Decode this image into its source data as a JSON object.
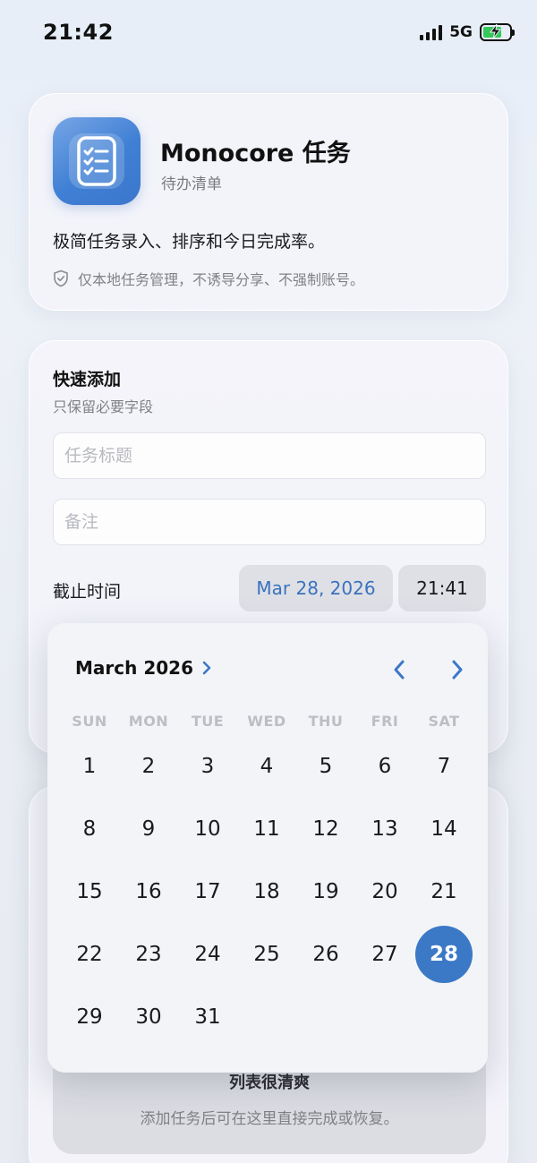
{
  "status": {
    "time": "21:42",
    "network": "5G"
  },
  "app": {
    "title": "Monocore 任务",
    "subtitle": "待办清单",
    "description": "极简任务录入、排序和今日完成率。",
    "privacy": "仅本地任务管理，不诱导分享、不强制账号。"
  },
  "quick_add": {
    "title": "快速添加",
    "subtitle": "只保留必要字段",
    "title_placeholder": "任务标题",
    "note_placeholder": "备注",
    "due_label": "截止时间",
    "due_date": "Mar 28, 2026",
    "due_time": "21:41"
  },
  "calendar": {
    "month_label": "March 2026",
    "weekdays": [
      "SUN",
      "MON",
      "TUE",
      "WED",
      "THU",
      "FRI",
      "SAT"
    ],
    "days": [
      "1",
      "2",
      "3",
      "4",
      "5",
      "6",
      "7",
      "8",
      "9",
      "10",
      "11",
      "12",
      "13",
      "14",
      "15",
      "16",
      "17",
      "18",
      "19",
      "20",
      "21",
      "22",
      "23",
      "24",
      "25",
      "26",
      "27",
      "28",
      "29",
      "30",
      "31"
    ],
    "selected_day": "28"
  },
  "list": {
    "empty_title": "列表很清爽",
    "empty_subtitle": "添加任务后可在这里直接完成或恢复。"
  },
  "colors": {
    "accent": "#3b79c6",
    "battery": "#34c759"
  }
}
